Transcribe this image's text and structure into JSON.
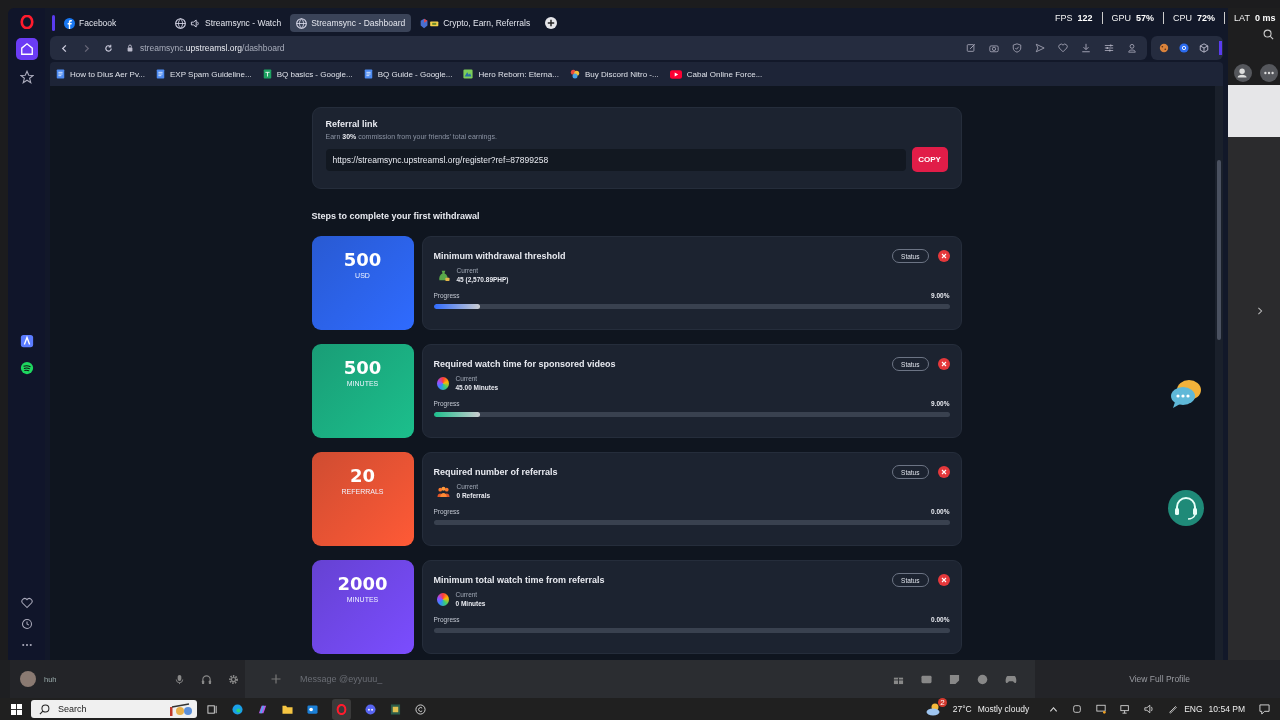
{
  "overlay": [
    {
      "label": "FPS",
      "value": "122"
    },
    {
      "label": "GPU",
      "value": "57%"
    },
    {
      "label": "CPU",
      "value": "72%"
    },
    {
      "label": "LAT",
      "value": "0 ms"
    }
  ],
  "sidebar": {
    "top": [
      {
        "kind": "home",
        "selected": true
      },
      {
        "kind": "star",
        "selected": false
      }
    ],
    "apps": [
      {
        "kind": "aria",
        "selected": false
      },
      {
        "kind": "spotify",
        "selected": false
      }
    ],
    "bottom": [
      {
        "kind": "heart",
        "selected": false
      },
      {
        "kind": "clock",
        "selected": false
      },
      {
        "kind": "more",
        "selected": false
      }
    ]
  },
  "tabs": [
    {
      "title": "Facebook",
      "kind": "facebook",
      "audio": false,
      "selected": false
    },
    {
      "title": "Streamsync - Watch",
      "kind": "globe",
      "audio": true,
      "selected": false
    },
    {
      "title": "Streamsync - Dashboard",
      "kind": "globe",
      "audio": false,
      "selected": true
    },
    {
      "title": "Crypto, Earn, Referrals",
      "kind": "crypto",
      "audio": false,
      "selected": false
    }
  ],
  "address_bar": {
    "url": "streamsync.**upstreamsl.org**/dashboard"
  },
  "bookmarks": [
    {
      "title": "How to Dius Aer Pv...",
      "kind": "doc"
    },
    {
      "title": "EXP Spam Guideline...",
      "kind": "doc"
    },
    {
      "title": "BQ basics - Google...",
      "kind": "sheet"
    },
    {
      "title": "BQ Guide - Google...",
      "kind": "doc"
    },
    {
      "title": "Hero Reborn: Eterna...",
      "kind": "game"
    },
    {
      "title": "Buy Discord Nitro -...",
      "kind": "swirl"
    },
    {
      "title": "Cabal Online Force...",
      "kind": "video"
    }
  ],
  "referral": {
    "title": "Referral link",
    "subtitle": "Earn **30%** commission from your friends’ total earnings.",
    "link": "https://streamsync.upstreamsl.org/register?ref=87899258",
    "button": "COPY"
  },
  "steps_heading": "Steps to complete your first withdrawal",
  "steps": [
    {
      "amount": "500",
      "unit": "USD",
      "color": "#2f6bff",
      "title": "Minimum withdrawal threshold",
      "kind": "money",
      "current_label": "Current",
      "current": "45  (2,570.89PHP)",
      "progress_label": "Progress",
      "percent": "9.00%",
      "level": 0.09,
      "status": "Status"
    },
    {
      "amount": "500",
      "unit": "MINUTES",
      "color": "#1cbf8c",
      "title": "Required watch time for sponsored videos",
      "kind": "rainbow",
      "current_label": "Current",
      "current": "45.00 Minutes",
      "progress_label": "Progress",
      "percent": "9.00%",
      "level": 0.09,
      "status": "Status"
    },
    {
      "amount": "20",
      "unit": "REFERRALS",
      "color": "#ff5a36",
      "title": "Required number of referrals",
      "kind": "people",
      "current_label": "Current",
      "current": "0 Referrals",
      "progress_label": "Progress",
      "percent": "0.00%",
      "level": 0,
      "status": "Status"
    },
    {
      "amount": "2000",
      "unit": "MINUTES",
      "color": "#7b4dff",
      "title": "Minimum total watch time from referrals",
      "kind": "rainbow",
      "current_label": "Current",
      "current": "0 Minutes",
      "progress_label": "Progress",
      "percent": "0.00%",
      "level": 0,
      "status": "Status"
    }
  ],
  "discord": {
    "status": "huh",
    "message_placeholder": "Message @eyyuuu_",
    "view_profile": "View Full Profile"
  },
  "taskbar": {
    "search": "Search",
    "weather_badge": "2",
    "temperature": "27°C",
    "weather": "Mostly cloudy",
    "language": "ENG",
    "time": "10:54 PM"
  }
}
